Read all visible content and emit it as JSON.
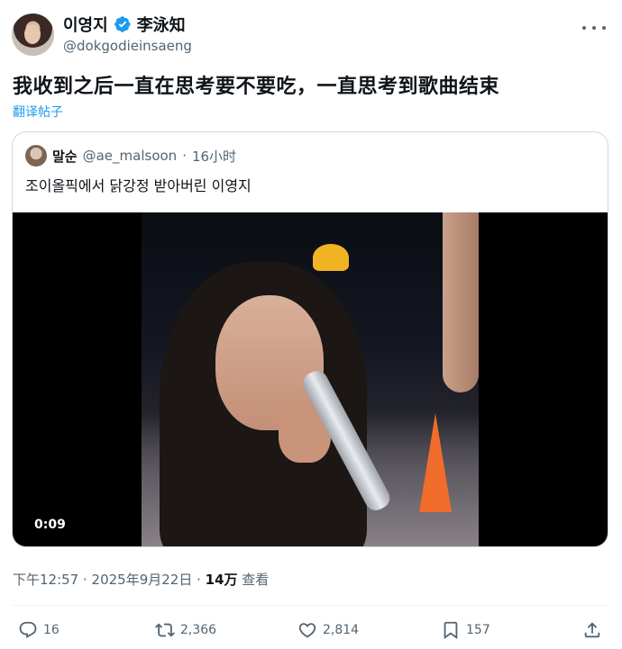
{
  "author": {
    "display_name": "이영지",
    "badge_name": "李泳知",
    "handle": "@dokgodieinsaeng"
  },
  "post": {
    "text": "我收到之后一直在思考要不要吃，一直思考到歌曲结束",
    "translate_link": "翻译帖子",
    "timestamp": "下午12:57 · 2025年9月22日 · ",
    "views_count": "14万",
    "views_label": " 查看"
  },
  "quote": {
    "name": "말순",
    "handle": "@ae_malsoon",
    "separator": "·",
    "time": "16小时",
    "text": "조이올픽에서 닭강정 받아버린 이영지",
    "video_duration": "0:09"
  },
  "actions": {
    "replies": "16",
    "reposts": "2,366",
    "likes": "2,814",
    "bookmarks": "157"
  },
  "colors": {
    "accent": "#1d9bf0",
    "muted": "#536471",
    "text": "#0f1419"
  }
}
